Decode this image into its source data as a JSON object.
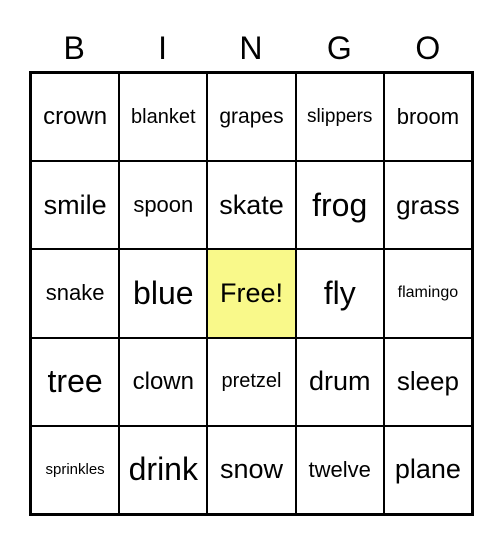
{
  "header": [
    "B",
    "I",
    "N",
    "G",
    "O"
  ],
  "cells": [
    [
      "crown",
      "blanket",
      "grapes",
      "slippers",
      "broom"
    ],
    [
      "smile",
      "spoon",
      "skate",
      "frog",
      "grass"
    ],
    [
      "snake",
      "blue",
      "Free!",
      "fly",
      "flamingo"
    ],
    [
      "tree",
      "clown",
      "pretzel",
      "drum",
      "sleep"
    ],
    [
      "sprinkles",
      "drink",
      "snow",
      "twelve",
      "plane"
    ]
  ],
  "free_cell_color": "#f9f98a"
}
